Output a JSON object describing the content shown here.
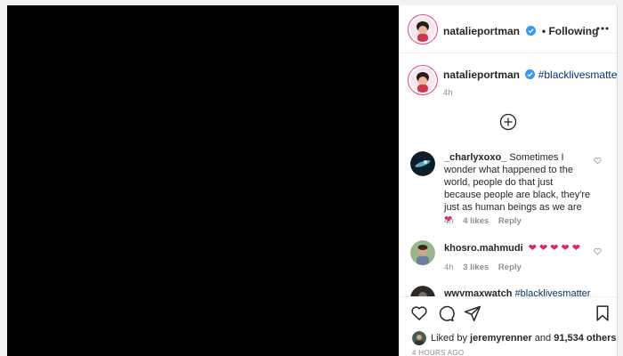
{
  "post": {
    "author": "natalieportman",
    "follow_status": "• Following",
    "caption_hashtag": "#blacklivesmatter",
    "caption_time": "4h"
  },
  "comments": [
    {
      "user": "_charlyxoxo_",
      "text": "Sometimes I wonder what happened to the world, people do that just because people are black, they're just as human beings as we are",
      "emoji": "❤",
      "time": "4h",
      "likes": "4 likes",
      "reply": "Reply"
    },
    {
      "user": "khosro.mahmudi",
      "emoji": "❤ ❤ ❤ ❤ ❤",
      "time": "4h",
      "likes": "3 likes",
      "reply": "Reply"
    },
    {
      "user": "wwymaxwatch",
      "text": "#blacklivesmatter"
    }
  ],
  "likes": {
    "prefix": "Liked by ",
    "liker": "jeremyrenner",
    "middle": " and ",
    "others": "91,534 others"
  },
  "timestamp": "4 HOURS AGO",
  "colors": {
    "verified": "#3897f0",
    "heart": "#e0245e",
    "hashtag": "#00376b"
  }
}
